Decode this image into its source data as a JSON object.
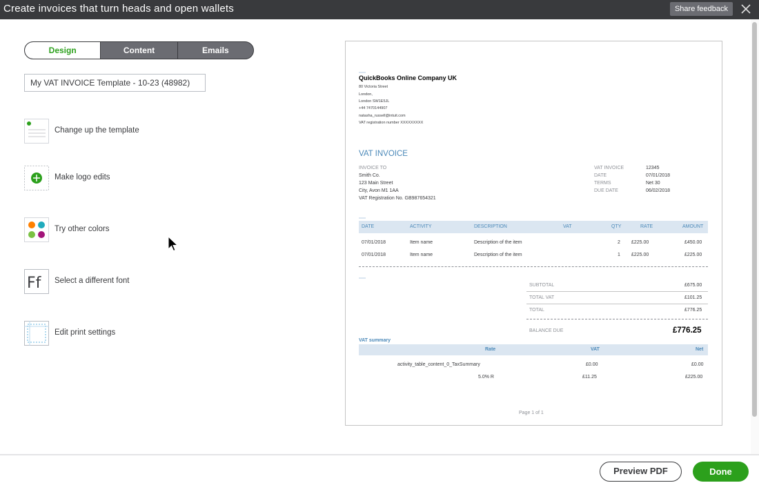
{
  "window": {
    "title": "Create invoices that turn heads and open wallets",
    "feedback_label": "Share feedback",
    "close_icon": "close-icon"
  },
  "tabs": [
    {
      "label": "Design",
      "active": true
    },
    {
      "label": "Content",
      "active": false
    },
    {
      "label": "Emails",
      "active": false
    }
  ],
  "template_name": "My VAT INVOICE Template - 10-23 (48982)",
  "options": [
    {
      "label": "Change up the template",
      "icon": "template-icon"
    },
    {
      "label": "Make logo edits",
      "icon": "add-logo-icon"
    },
    {
      "label": "Try other colors",
      "icon": "color-palette-icon"
    },
    {
      "label": "Select a different font",
      "icon": "font-icon"
    },
    {
      "label": "Edit print settings",
      "icon": "print-settings-icon"
    }
  ],
  "colors": {
    "accent": "#2ca01c",
    "titlebar": "#393a3d",
    "invoice_blue": "#4a88b8",
    "table_head": "#dbe6f1"
  },
  "invoice": {
    "company": {
      "name": "QuickBooks Online Company UK",
      "address1": "80 Victoria Street",
      "address2": "London,",
      "address3": "London SW1E5JL",
      "phone": "+44 7470144907",
      "email": "natasha_russell@intuit.com",
      "vat_reg": "VAT registration number XXXXXXXXX"
    },
    "title": "VAT INVOICE",
    "invoice_to_label": "INVOICE TO",
    "bill_to": [
      "Smith Co.",
      "123 Main Street",
      "City, Avon M1 1AA",
      "VAT Registration No. GB987654321"
    ],
    "meta": [
      {
        "label": "VAT INVOICE",
        "value": "12345"
      },
      {
        "label": "DATE",
        "value": "07/01/2018"
      },
      {
        "label": "TERMS",
        "value": "Net 30"
      },
      {
        "label": "DUE DATE",
        "value": "06/02/2018"
      }
    ],
    "columns": {
      "date": "DATE",
      "activity": "ACTIVITY",
      "description": "DESCRIPTION",
      "vat": "VAT",
      "qty": "QTY",
      "rate": "RATE",
      "amount": "AMOUNT"
    },
    "rows": [
      {
        "date": "07/01/2018",
        "activity": "Item name",
        "description": "Description of the item",
        "qty": "2",
        "rate": "£225.00",
        "amount": "£450.00"
      },
      {
        "date": "07/01/2018",
        "activity": "Item name",
        "description": "Description of the item",
        "qty": "1",
        "rate": "£225.00",
        "amount": "£225.00"
      }
    ],
    "totals": {
      "subtotal_label": "SUBTOTAL",
      "subtotal": "£675.00",
      "total_vat_label": "TOTAL VAT",
      "total_vat": "£101.25",
      "total_label": "TOTAL",
      "total": "£776.25",
      "balance_label": "BALANCE DUE",
      "balance": "£776.25"
    },
    "vat_summary": {
      "title": "VAT summary",
      "columns": {
        "rate": "Rate",
        "vat": "VAT",
        "net": "Net"
      },
      "rows": [
        {
          "rate": "activity_table_content_0_TaxSummary",
          "vat": "£0.00",
          "net": "£0.00"
        },
        {
          "rate": "5.0% R",
          "vat": "£11.25",
          "net": "£225.00"
        }
      ]
    },
    "page_label": "Page 1 of 1"
  },
  "footer": {
    "preview_label": "Preview PDF",
    "done_label": "Done"
  }
}
